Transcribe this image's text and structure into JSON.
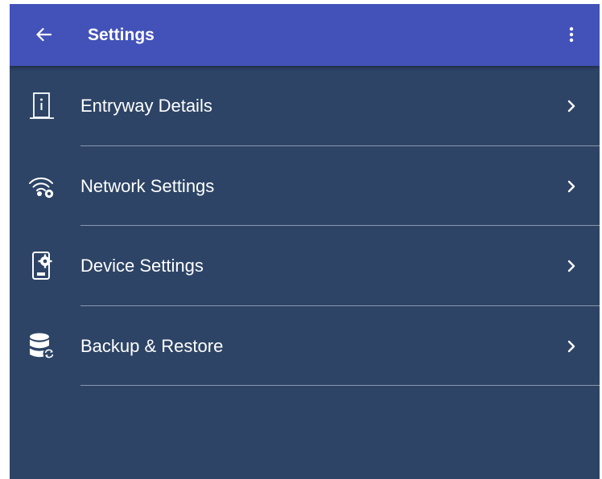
{
  "colors": {
    "appbar": "#4352b8",
    "background": "#2d4466",
    "divider": "#8a98ad",
    "text": "#ffffff"
  },
  "appbar": {
    "title": "Settings",
    "back_icon": "arrow-left-icon",
    "menu_icon": "more-vertical-icon"
  },
  "items": [
    {
      "label": "Entryway Details",
      "icon": "door-info-icon"
    },
    {
      "label": "Network Settings",
      "icon": "wifi-gear-icon"
    },
    {
      "label": "Device Settings",
      "icon": "tablet-gear-icon"
    },
    {
      "label": "Backup & Restore",
      "icon": "database-sync-icon"
    }
  ]
}
